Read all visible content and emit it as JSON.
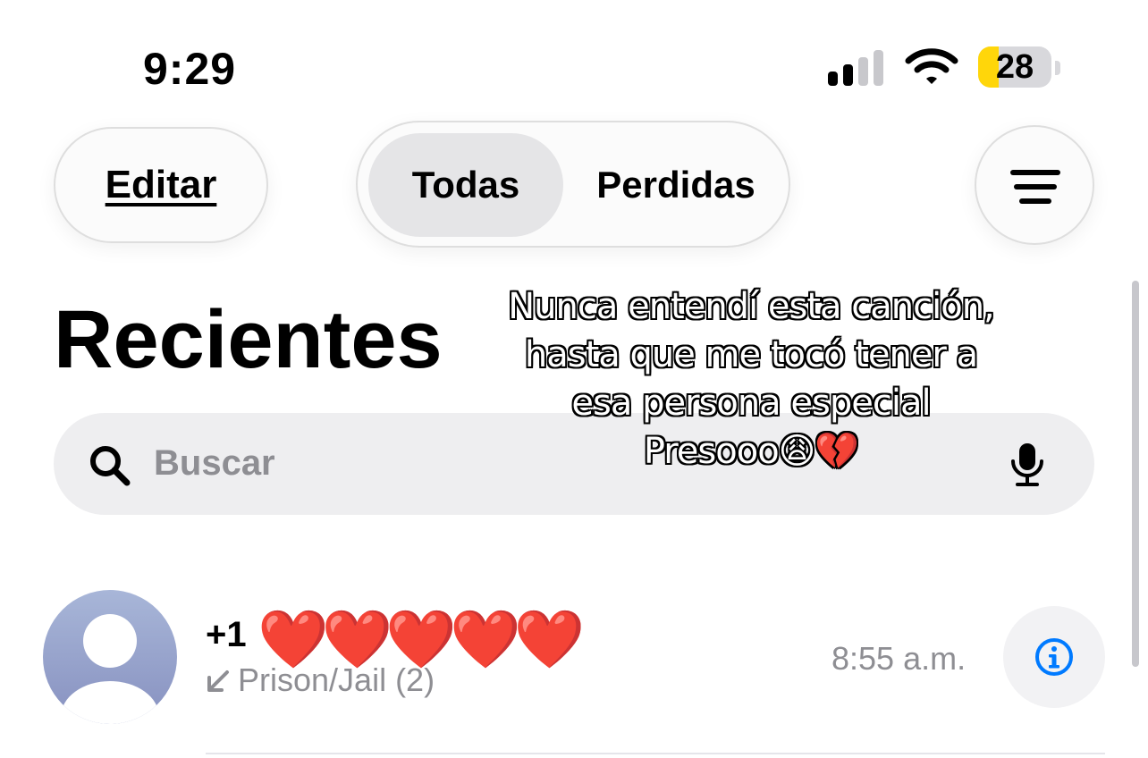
{
  "status_bar": {
    "time": "9:29",
    "battery_level": "28",
    "battery_fraction": 0.28,
    "signal_bars_active": 2,
    "signal_bars_total": 4,
    "icons": [
      "cellular-signal-icon",
      "wifi-icon",
      "battery-icon"
    ]
  },
  "toolbar": {
    "edit_label": "Editar",
    "segments": [
      {
        "label": "Todas",
        "selected": true
      },
      {
        "label": "Perdidas",
        "selected": false
      }
    ],
    "filter_icon": "filter-lines-icon"
  },
  "page": {
    "title": "Recientes"
  },
  "search": {
    "placeholder": "Buscar",
    "icons": [
      "search-icon",
      "microphone-icon"
    ]
  },
  "caption_overlay": {
    "lines": [
      "Nunca entendí esta canción,",
      "hasta que me tocó tener a",
      "esa persona especial",
      "Presooo😩💔"
    ]
  },
  "recents": [
    {
      "name_prefix": "+1",
      "name_obscured": "❤️❤️❤️❤️❤️",
      "label": "Prison/Jail (2)",
      "time": "8:55 a.m.",
      "direction_icon": "incoming-call-arrow-icon",
      "info_icon": "info-icon"
    }
  ],
  "colors": {
    "accent": "#007aff",
    "battery_fill": "#ffd60a",
    "secondary_text": "#8e8e93",
    "search_bg": "#eeeef0"
  }
}
